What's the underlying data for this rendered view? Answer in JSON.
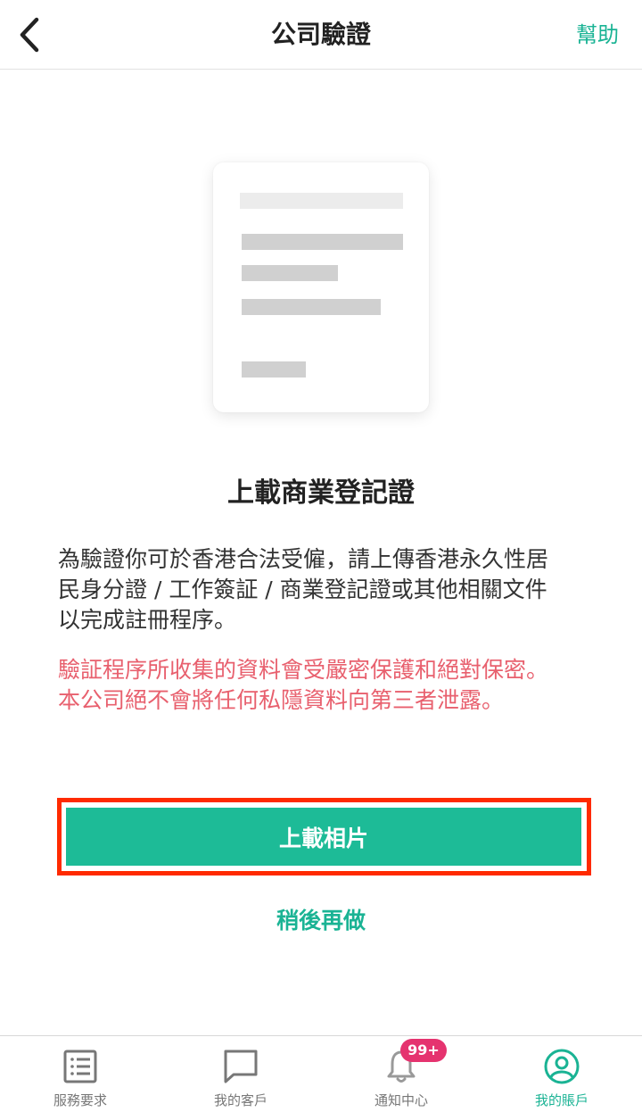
{
  "header": {
    "title": "公司驗證",
    "help_label": "幫助"
  },
  "main": {
    "heading": "上載商業登記證",
    "description_lines": [
      "為驗證你可於香港合法受僱，請上傳香港永久性居",
      "民身分證 / 工作簽証 / 商業登記證或其他相關文件",
      "以完成註冊程序。"
    ],
    "privacy_lines": [
      "驗証程序所收集的資料會受嚴密保護和絕對保密。",
      "本公司絕不會將任何私隱資料向第三者泄露。"
    ],
    "upload_label": "上載相片",
    "later_label": "稍後再做"
  },
  "tabbar": {
    "items": [
      {
        "label": "服務要求",
        "icon": "list-icon",
        "active": false
      },
      {
        "label": "我的客戶",
        "icon": "chat-icon",
        "active": false
      },
      {
        "label": "通知中心",
        "icon": "bell-icon",
        "active": false
      },
      {
        "label": "我的賬戶",
        "icon": "user-icon",
        "active": true
      }
    ],
    "notification_badge": "99+"
  },
  "colors": {
    "accent": "#1dbb97",
    "privacy_text": "#e8606e",
    "badge": "#e5336f",
    "highlight_border": "#ff2a00"
  }
}
